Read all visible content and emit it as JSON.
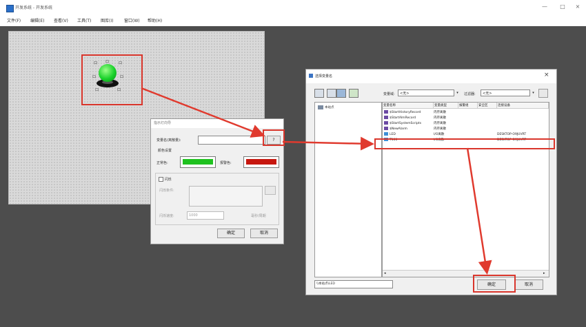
{
  "window": {
    "title": "开发系统 - 开发系统",
    "controls": [
      "—",
      "□",
      "×"
    ]
  },
  "menu": [
    "文件(F)",
    "编辑(E)",
    "查看(V)",
    "工具(T)",
    "图库(I)",
    "窗口(W)",
    "帮助(H)"
  ],
  "canvas": {
    "led_handles": [
      "口",
      "口",
      "口",
      "口",
      "口",
      "口",
      "口"
    ]
  },
  "dialog1": {
    "title": "指示灯向导",
    "var_label": "变量名(离散量):",
    "var_value": "",
    "var_btn": "?",
    "color_group": "颜色设置",
    "normal_color_label": "正常色:",
    "alarm_color_label": "报警色:",
    "normal_color": "#1fc21f",
    "alarm_color": "#c7170f",
    "flash_check": "闪烁",
    "flash_cond_label": "闪烁条件:",
    "flash_speed_label": "闪烁速度:",
    "flash_speed_value": "1000",
    "flash_speed_unit": "毫秒/周期",
    "ok": "确定",
    "cancel": "取消"
  },
  "dialog2": {
    "title": "选择变量名",
    "close": "×",
    "var_domain_label": "变量域:",
    "var_domain_value": "<无>",
    "filter_label": "过滤器:",
    "filter_value": "<无>",
    "tree_root": "本站点",
    "columns": [
      "变量名称",
      "变量类型",
      "报警组",
      "安全区",
      "连接设备"
    ],
    "rows": [
      {
        "name": "$StartHistoryRecord",
        "type": "内存离散",
        "group": "",
        "zone": "",
        "device": ""
      },
      {
        "name": "$StartAlmRecord",
        "type": "内存离散",
        "group": "",
        "zone": "",
        "device": ""
      },
      {
        "name": "$StartSystemScripts",
        "type": "内存离散",
        "group": "",
        "zone": "",
        "device": ""
      },
      {
        "name": "$NewAlarm",
        "type": "内存离散",
        "group": "",
        "zone": "",
        "device": ""
      },
      {
        "name": "LED",
        "type": "I/O离散",
        "group": "",
        "zone": "",
        "device": "DESKTOP-O9JUVRT"
      },
      {
        "name": "T100",
        "type": "I/O离散",
        "group": "",
        "zone": "",
        "device": "DESKTOP-O9JUVRT"
      }
    ],
    "selected_path": "\\\\本站点\\LED",
    "ok": "确定",
    "cancel": "取消"
  },
  "colors": {
    "highlight": "#d9352b",
    "workspace": "#4d4d4d"
  }
}
